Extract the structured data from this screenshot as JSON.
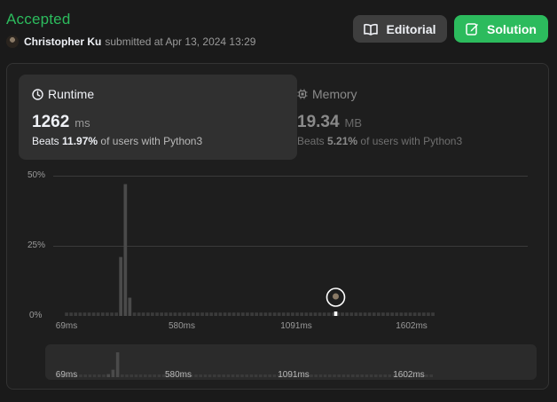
{
  "header": {
    "status": "Accepted",
    "submitter": "Christopher Ku",
    "submitted_text": "submitted at Apr 13, 2024 13:29",
    "editorial_label": "Editorial",
    "solution_label": "Solution"
  },
  "colors": {
    "accent": "#2cbb5d",
    "bar": "#3b3b3b",
    "bar_highlight": "#4a4a4a",
    "marker": "#ffffff"
  },
  "runtime": {
    "title": "Runtime",
    "value": "1262",
    "unit": "ms",
    "beats_prefix": "Beats",
    "beats_percent": "11.97%",
    "beats_suffix": "of users with Python3"
  },
  "memory": {
    "title": "Memory",
    "value": "19.34",
    "unit": "MB",
    "beats_prefix": "Beats",
    "beats_percent": "5.21%",
    "beats_suffix": "of users with Python3"
  },
  "icons": {
    "editorial": "book-icon",
    "solution": "edit-icon",
    "runtime": "clock-icon",
    "memory": "chip-icon"
  },
  "chart_data": {
    "type": "bar",
    "x_start_ms": 69,
    "bin_width_ms": 25.55,
    "bin_count": 82,
    "y_ticks": [
      "50%",
      "25%",
      "0%"
    ],
    "ylim": [
      0,
      50
    ],
    "x_ticks": [
      {
        "label": "69ms",
        "value": 69
      },
      {
        "label": "580ms",
        "value": 580
      },
      {
        "label": "1091ms",
        "value": 1091
      },
      {
        "label": "1602ms",
        "value": 1602
      }
    ],
    "peaks": [
      {
        "x_ms": 375,
        "percent": 21
      },
      {
        "x_ms": 401,
        "percent": 47
      },
      {
        "x_ms": 426,
        "percent": 6.5
      }
    ],
    "baseline_percent": 1.2,
    "user_marker_ms": 1262
  },
  "minimap": {
    "ticks": [
      {
        "label": "69ms",
        "value": 69
      },
      {
        "label": "580ms",
        "value": 580
      },
      {
        "label": "1091ms",
        "value": 1091
      },
      {
        "label": "1602ms",
        "value": 1602
      }
    ],
    "peaks": [
      {
        "x_ms": 350,
        "percent": 12
      },
      {
        "x_ms": 375,
        "percent": 30
      },
      {
        "x_ms": 401,
        "percent": 100
      }
    ]
  }
}
